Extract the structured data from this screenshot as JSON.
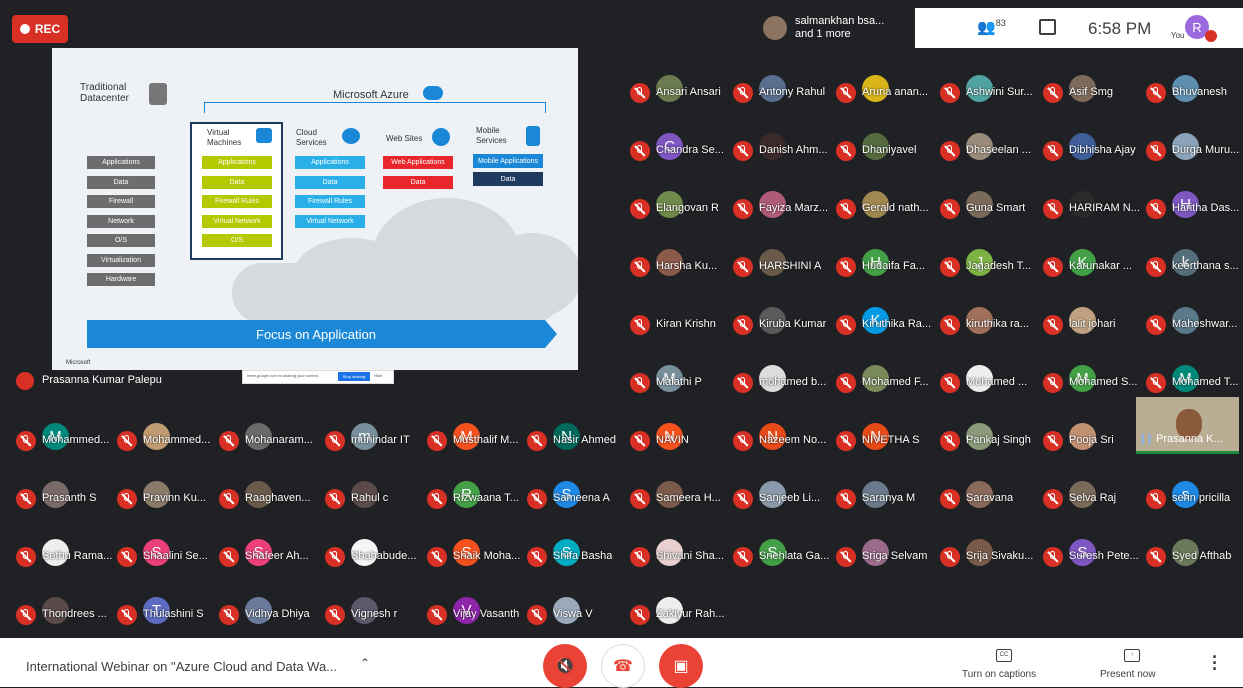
{
  "rec_label": "REC",
  "pinned": {
    "name": "salmankhan bsa...",
    "more": "and 1 more"
  },
  "topbar": {
    "people_icon": "people-icon",
    "participant_count": "83",
    "chat_icon": "chat-icon",
    "time": "6:58 PM",
    "you_label": "You",
    "avatar_letter": "R"
  },
  "slide": {
    "traditional": "Traditional\nDatacenter",
    "azure": "Microsoft Azure",
    "stack": [
      "Applications",
      "Data",
      "Firewall",
      "Network",
      "O/S",
      "Virtualization",
      "Hardware"
    ],
    "vm_title": "Virtual\nMachines",
    "vm_items": [
      "Applications",
      "Data",
      "Firewall Rules",
      "Virtual Network",
      "O/S"
    ],
    "cloud_title": "Cloud\nServices",
    "cloud_items": [
      "Applications",
      "Data",
      "Firewall Rules",
      "Virtual Network"
    ],
    "web_title": "Web Sites",
    "web_items": [
      "Web Applications",
      "Data"
    ],
    "mobile_title": "Mobile\nServices",
    "mobile_items": [
      "Mobile Applications",
      "Data"
    ],
    "focus": "Focus on Application",
    "footer": "Microsoft",
    "share_text": "meet.google.com is sharing your screen.",
    "share_stop": "Stop sharing",
    "share_hide": "Hide"
  },
  "presenter_name": "Prasanna Kumar Palepu",
  "self_tile_name": "Prasanna K...",
  "participants": [
    {
      "name": "Ansari Ansari",
      "color": "#6b7a4f",
      "letter": ""
    },
    {
      "name": "Antony Rahul",
      "color": "#5a6f8f",
      "letter": ""
    },
    {
      "name": "Aruna anan...",
      "color": "#d9b51a",
      "letter": ""
    },
    {
      "name": "Ashwini Sur...",
      "color": "#4fa3a0",
      "letter": ""
    },
    {
      "name": "Asif Smg",
      "color": "#7d6a5b",
      "letter": ""
    },
    {
      "name": "Bhuvanesh",
      "color": "#5e8fb0",
      "letter": ""
    },
    {
      "name": "Chandra Se...",
      "color": "#7e57c2",
      "letter": "C"
    },
    {
      "name": "Danish Ahm...",
      "color": "#3a2a2a",
      "letter": ""
    },
    {
      "name": "Dhaniyavel",
      "color": "#556b3f",
      "letter": ""
    },
    {
      "name": "Dhaseelan ...",
      "color": "#9a8a7a",
      "letter": ""
    },
    {
      "name": "Dibhisha Ajay",
      "color": "#3f5e9a",
      "letter": ""
    },
    {
      "name": "Durga Muru...",
      "color": "#8aa3b8",
      "letter": ""
    },
    {
      "name": "Elangovan R",
      "color": "#6f8a4a",
      "letter": ""
    },
    {
      "name": "Fayiza Marz...",
      "color": "#b05a7a",
      "letter": ""
    },
    {
      "name": "Gerald nath...",
      "color": "#a08850",
      "letter": ""
    },
    {
      "name": "Guna Smart",
      "color": "#7a6a5a",
      "letter": ""
    },
    {
      "name": "HARIRAM N...",
      "color": "#2a2a2a",
      "letter": ""
    },
    {
      "name": "Haritha Das...",
      "color": "#7e57c2",
      "letter": "H"
    },
    {
      "name": "Harsha Ku...",
      "color": "#8a5a4a",
      "letter": ""
    },
    {
      "name": "HARSHINI A",
      "color": "#6a5a4a",
      "letter": ""
    },
    {
      "name": "Hudaifa Fa...",
      "color": "#43a047",
      "letter": "H"
    },
    {
      "name": "Jagadesh T...",
      "color": "#7cb342",
      "letter": "J"
    },
    {
      "name": "Karunakar ...",
      "color": "#43a047",
      "letter": "K"
    },
    {
      "name": "keerthana s...",
      "color": "#546e7a",
      "letter": "k"
    },
    {
      "name": "Kiran Krishn",
      "color": "#202124",
      "letter": ""
    },
    {
      "name": "Kiruba Kumar",
      "color": "#5a5a5a",
      "letter": ""
    },
    {
      "name": "Kiruthika Ra...",
      "color": "#039be5",
      "letter": "K"
    },
    {
      "name": "kiruthika ra...",
      "color": "#a0705a",
      "letter": ""
    },
    {
      "name": "lalit johari",
      "color": "#c0a080",
      "letter": ""
    },
    {
      "name": "Maheshwar...",
      "color": "#5a7a8a",
      "letter": ""
    },
    {
      "name": "Malathi P",
      "color": "#78909c",
      "letter": "M"
    },
    {
      "name": "mohamed b...",
      "color": "#dddddd",
      "letter": ""
    },
    {
      "name": "Mohamed F...",
      "color": "#7a8a5a",
      "letter": ""
    },
    {
      "name": "Mohamed ...",
      "color": "#eeeeee",
      "letter": ""
    },
    {
      "name": "Mohamed S...",
      "color": "#43a047",
      "letter": "M"
    },
    {
      "name": "Mohamed T...",
      "color": "#00897b",
      "letter": "M"
    },
    {
      "name": "Mohammed...",
      "color": "#00897b",
      "letter": "M"
    },
    {
      "name": "Mohammed...",
      "color": "#c09a70",
      "letter": ""
    },
    {
      "name": "Mohanaram...",
      "color": "#6a6a6a",
      "letter": ""
    },
    {
      "name": "munindar IT",
      "color": "#78909c",
      "letter": "m"
    },
    {
      "name": "Musthalif M...",
      "color": "#f4511e",
      "letter": "M"
    },
    {
      "name": "Nasir Ahmed",
      "color": "#00695c",
      "letter": "N"
    },
    {
      "name": "NAVIN",
      "color": "#f4511e",
      "letter": "N"
    },
    {
      "name": "Nazeem No...",
      "color": "#e64a19",
      "letter": "N"
    },
    {
      "name": "NIVETHA S",
      "color": "#e64a19",
      "letter": "N"
    },
    {
      "name": "Pankaj Singh",
      "color": "#8a9a7a",
      "letter": ""
    },
    {
      "name": "Pooja Sri",
      "color": "#c09070",
      "letter": ""
    },
    {
      "name": "Prasanth S",
      "color": "#7a6a6a",
      "letter": ""
    },
    {
      "name": "Pravinn Ku...",
      "color": "#8a7a6a",
      "letter": ""
    },
    {
      "name": "Raaghaven...",
      "color": "#6a5a4a",
      "letter": ""
    },
    {
      "name": "Rahul c",
      "color": "#5a4a4a",
      "letter": ""
    },
    {
      "name": "Rizwaana T...",
      "color": "#43a047",
      "letter": "R"
    },
    {
      "name": "Sameena A",
      "color": "#1e88e5",
      "letter": "S"
    },
    {
      "name": "Sameera H...",
      "color": "#7a5a4a",
      "letter": ""
    },
    {
      "name": "Sanjeeb Li...",
      "color": "#8a9aaa",
      "letter": ""
    },
    {
      "name": "Saranya M",
      "color": "#6a7a8a",
      "letter": ""
    },
    {
      "name": "Saravana",
      "color": "#8a6a5a",
      "letter": ""
    },
    {
      "name": "Selva Raj",
      "color": "#7a6a5a",
      "letter": ""
    },
    {
      "name": "serin pricilla",
      "color": "#1e88e5",
      "letter": "s"
    },
    {
      "name": "Sethu Rama...",
      "color": "#eeeeee",
      "letter": ""
    },
    {
      "name": "Shaalini Se...",
      "color": "#ec407a",
      "letter": "S"
    },
    {
      "name": "Shafeer Ah...",
      "color": "#ec407a",
      "letter": "S"
    },
    {
      "name": "Shahabude...",
      "color": "#f5f5f5",
      "letter": ""
    },
    {
      "name": "Shaik Moha...",
      "color": "#f4511e",
      "letter": "S"
    },
    {
      "name": "Shifa Basha",
      "color": "#00acc1",
      "letter": "S"
    },
    {
      "name": "Shivani Sha...",
      "color": "#e8d0d0",
      "letter": ""
    },
    {
      "name": "Snehlata Ga...",
      "color": "#43a047",
      "letter": "S"
    },
    {
      "name": "Sriga Selvam",
      "color": "#9a6a8a",
      "letter": ""
    },
    {
      "name": "Srija Sivaku...",
      "color": "#7a5a4a",
      "letter": ""
    },
    {
      "name": "Suresh Pete...",
      "color": "#7e57c2",
      "letter": "S"
    },
    {
      "name": "Syed Afthab",
      "color": "#6a7a5a",
      "letter": ""
    },
    {
      "name": "Thondrees ...",
      "color": "#5a4a4a",
      "letter": ""
    },
    {
      "name": "Thulashini S",
      "color": "#5c6bc0",
      "letter": "T"
    },
    {
      "name": "Vidhya Dhiya",
      "color": "#6a7a9a",
      "letter": ""
    },
    {
      "name": "Vignesh r",
      "color": "#5a5a6a",
      "letter": ""
    },
    {
      "name": "Vijay Vasanth",
      "color": "#8e24aa",
      "letter": "V"
    },
    {
      "name": "Viswa V",
      "color": "#9aaabb",
      "letter": ""
    },
    {
      "name": "Zakiyur Rah...",
      "color": "#eeeeee",
      "letter": ""
    }
  ],
  "bottom": {
    "meeting_title": "International Webinar on \"Azure Cloud and Data Wa...",
    "caption_label": "Turn on captions",
    "present_label": "Present now",
    "colors": {
      "danger": "#ea4335"
    }
  }
}
